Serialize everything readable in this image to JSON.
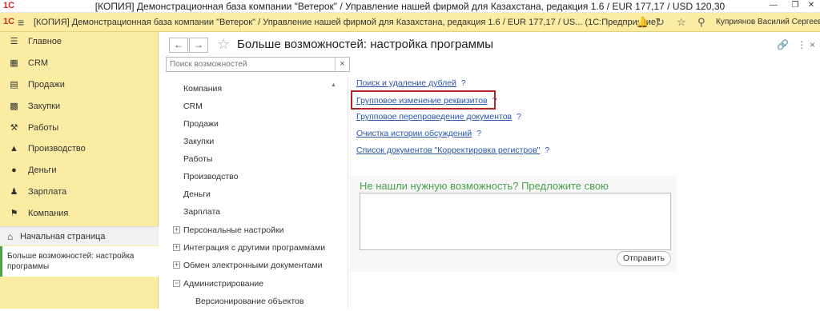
{
  "window": {
    "logo": "1С",
    "title": "[КОПИЯ] Демонстрационная база компании \"Ветерок\" / Управление нашей фирмой для Казахстана, редакция 1.6 / EUR 177,17 / USD 120,30"
  },
  "appbar": {
    "title": "[КОПИЯ] Демонстрационная база компании \"Ветерок\" / Управление нашей фирмой для Казахстана, редакция 1.6 / EUR 177,17 / US...  (1С:Предприятие)",
    "user": "Куприянов Василий Сергеевич"
  },
  "sidebar": {
    "items": [
      {
        "label": "Главное",
        "icon": "menu-icon"
      },
      {
        "label": "CRM",
        "icon": "crm-icon"
      },
      {
        "label": "Продажи",
        "icon": "cart-icon"
      },
      {
        "label": "Закупки",
        "icon": "purchase-icon"
      },
      {
        "label": "Работы",
        "icon": "tools-icon"
      },
      {
        "label": "Производство",
        "icon": "factory-icon"
      },
      {
        "label": "Деньги",
        "icon": "coin-icon"
      },
      {
        "label": "Зарплата",
        "icon": "people-icon"
      },
      {
        "label": "Компания",
        "icon": "flag-icon"
      }
    ],
    "home": "Начальная страница",
    "opened": "Больше возможностей: настройка программы"
  },
  "main": {
    "title": "Больше возможностей: настройка программы",
    "search_placeholder": "Поиск возможностей",
    "tree": [
      {
        "label": "Компания",
        "expander": ""
      },
      {
        "label": "CRM",
        "expander": ""
      },
      {
        "label": "Продажи",
        "expander": ""
      },
      {
        "label": "Закупки",
        "expander": ""
      },
      {
        "label": "Работы",
        "expander": ""
      },
      {
        "label": "Производство",
        "expander": ""
      },
      {
        "label": "Деньги",
        "expander": ""
      },
      {
        "label": "Зарплата",
        "expander": ""
      },
      {
        "label": "Персональные настройки",
        "expander": "+"
      },
      {
        "label": "Интеграция с другими программами",
        "expander": "+"
      },
      {
        "label": "Обмен электронными документами",
        "expander": "+"
      },
      {
        "label": "Администрирование",
        "expander": "−"
      },
      {
        "label": "Версионирование объектов",
        "expander": ""
      }
    ],
    "links": [
      {
        "label": "Поиск и удаление дублей",
        "q": "?"
      },
      {
        "label": "Групповое изменение реквизитов",
        "q": "?"
      },
      {
        "label": "Групповое перепроведение документов",
        "q": "?"
      },
      {
        "label": "Очистка истории обсуждений",
        "q": "?"
      },
      {
        "label": "Список документов \"Корректировка регистров\"",
        "q": "?"
      }
    ],
    "suggest_heading": "Не нашли нужную возможность? Предложите свою",
    "send_label": "Отправить"
  },
  "colors": {
    "accent_panel": "#fbeca4",
    "link": "#2a56a8",
    "highlight": "#b62525",
    "suggest_heading": "#4aa04a"
  }
}
